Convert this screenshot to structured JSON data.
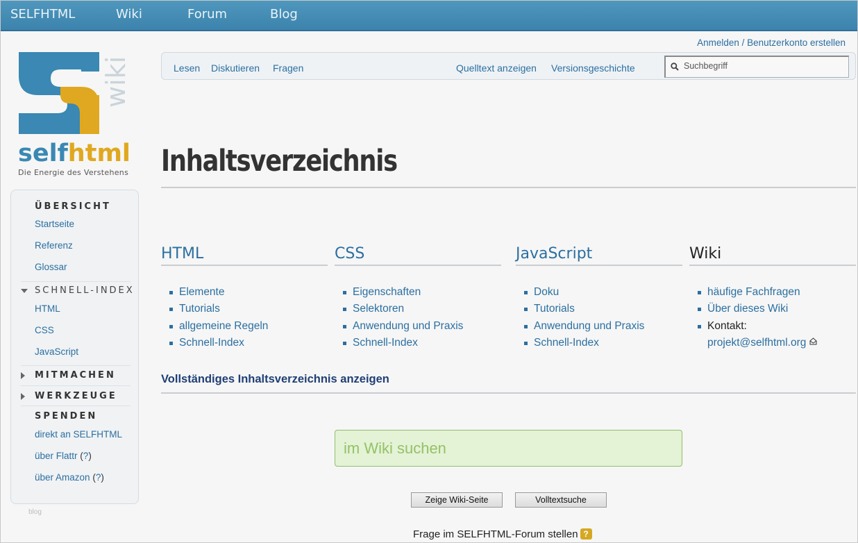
{
  "topnav": [
    "SELFHTML",
    "Wiki",
    "Forum",
    "Blog"
  ],
  "logo": {
    "wordmark_a": "self",
    "wordmark_b": "html",
    "wiki_label": "wiki",
    "tagline": "Die Energie des Verstehens",
    "colors": {
      "blue": "#3a88b3",
      "gold": "#e0a820"
    }
  },
  "account": {
    "login": "Anmelden",
    "sep": " / ",
    "register": "Benutzerkonto erstellen"
  },
  "tabs": {
    "read": "Lesen",
    "discuss": "Diskutieren",
    "ask": "Fragen",
    "source": "Quelltext anzeigen",
    "history": "Versionsgeschichte"
  },
  "search": {
    "placeholder": "Suchbegriff"
  },
  "sidebar": {
    "overview": "ÜBERSICHT",
    "overview_items": [
      "Startseite",
      "Referenz",
      "Glossar"
    ],
    "quick_index": "SCHNELL-INDEX",
    "quick_items": [
      "HTML",
      "CSS",
      "JavaScript"
    ],
    "contribute": "MITMACHEN",
    "tools": "WERKZEUGE",
    "donate": "SPENDEN",
    "donate_direct": "direkt an SELFHTML",
    "donate_flattr": "über Flattr",
    "donate_amazon": "über Amazon",
    "q_open": "(",
    "q_mark": "?",
    "q_close": ")",
    "footer_faint": "blog"
  },
  "main": {
    "title": "Inhaltsverzeichnis",
    "columns": [
      {
        "heading": "HTML",
        "items": [
          "Elemente",
          "Tutorials",
          "allgemeine Regeln",
          "Schnell-Index"
        ]
      },
      {
        "heading": "CSS",
        "items": [
          "Eigenschaften",
          "Selektoren",
          "Anwendung und Praxis",
          "Schnell-Index"
        ]
      },
      {
        "heading": "JavaScript",
        "items": [
          "Doku",
          "Tutorials",
          "Anwendung und Praxis",
          "Schnell-Index"
        ]
      },
      {
        "heading": "Wiki",
        "items": [
          "häufige Fachfragen",
          "Über dieses Wiki"
        ],
        "contact_label": "Kontakt:",
        "contact_email": "projekt@selfhtml.org"
      }
    ],
    "full_index_link": "Vollständiges Inhaltsverzeichnis anzeigen",
    "wiki_search_placeholder": "im Wiki suchen",
    "btn_show_page": "Zeige Wiki-Seite",
    "btn_fulltext": "Volltextsuche",
    "forum_prompt": "Frage im SELFHTML-Forum stellen",
    "forum_q": "?"
  }
}
